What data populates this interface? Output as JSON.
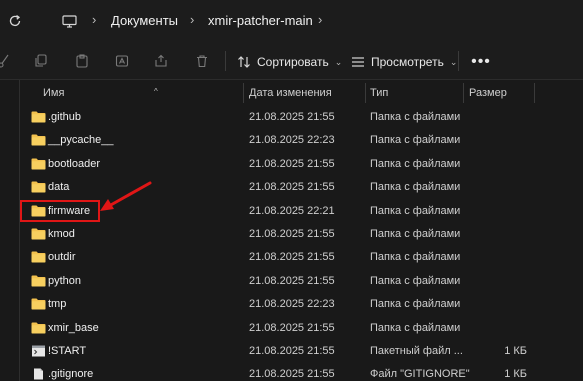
{
  "address_bar": {
    "crumbs": [
      "Документы",
      "xmir-patcher-main"
    ]
  },
  "toolbar": {
    "sort_label": "Сортировать",
    "view_label": "Просмотреть"
  },
  "columns": {
    "name": "Имя",
    "date": "Дата изменения",
    "type": "Тип",
    "size": "Размер"
  },
  "files": [
    {
      "name": ".github",
      "date": "21.08.2025 21:55",
      "type": "Папка с файлами",
      "size": "",
      "icon": "folder-icon"
    },
    {
      "name": "__pycache__",
      "date": "21.08.2025 22:23",
      "type": "Папка с файлами",
      "size": "",
      "icon": "folder-icon"
    },
    {
      "name": "bootloader",
      "date": "21.08.2025 21:55",
      "type": "Папка с файлами",
      "size": "",
      "icon": "folder-icon"
    },
    {
      "name": "data",
      "date": "21.08.2025 21:55",
      "type": "Папка с файлами",
      "size": "",
      "icon": "folder-icon"
    },
    {
      "name": "firmware",
      "date": "21.08.2025 22:21",
      "type": "Папка с файлами",
      "size": "",
      "icon": "folder-icon"
    },
    {
      "name": "kmod",
      "date": "21.08.2025 21:55",
      "type": "Папка с файлами",
      "size": "",
      "icon": "folder-icon"
    },
    {
      "name": "outdir",
      "date": "21.08.2025 21:55",
      "type": "Папка с файлами",
      "size": "",
      "icon": "folder-icon"
    },
    {
      "name": "python",
      "date": "21.08.2025 21:55",
      "type": "Папка с файлами",
      "size": "",
      "icon": "folder-icon"
    },
    {
      "name": "tmp",
      "date": "21.08.2025 22:23",
      "type": "Папка с файлами",
      "size": "",
      "icon": "folder-icon"
    },
    {
      "name": "xmir_base",
      "date": "21.08.2025 21:55",
      "type": "Папка с файлами",
      "size": "",
      "icon": "folder-icon"
    },
    {
      "name": "!START",
      "date": "21.08.2025 21:55",
      "type": "Пакетный файл ...",
      "size": "1 КБ",
      "icon": "batch-file-icon"
    },
    {
      "name": ".gitignore",
      "date": "21.08.2025 21:55",
      "type": "Файл \"GITIGNORE\"",
      "size": "1 КБ",
      "icon": "file-icon"
    }
  ],
  "annotation": {
    "highlighted_item": "firmware",
    "highlight_color": "#e01616"
  },
  "colors": {
    "folder": "#f2c14e",
    "background": "#191919",
    "toolbar": "#1c1c1c"
  }
}
